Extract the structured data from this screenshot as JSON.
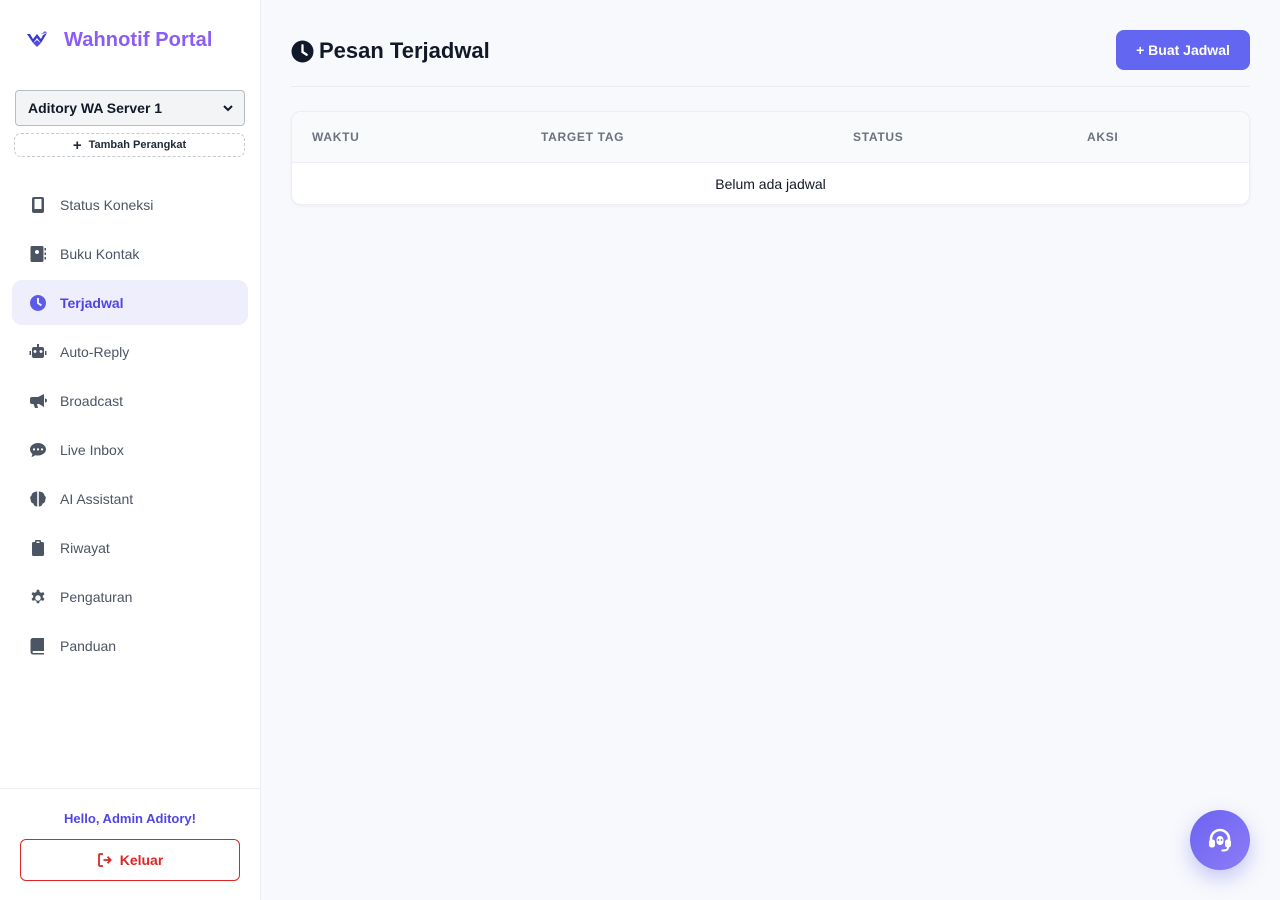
{
  "brand": {
    "title": "Wahnotif Portal",
    "logo_icon": "bird-logo-icon"
  },
  "device": {
    "selected": "Aditory WA Server 1",
    "add_label": "Tambah Perangkat"
  },
  "nav": {
    "items": [
      {
        "label": "Status Koneksi",
        "icon": "phone-icon",
        "active": false
      },
      {
        "label": "Buku Kontak",
        "icon": "address-book-icon",
        "active": false
      },
      {
        "label": "Terjadwal",
        "icon": "clock-icon",
        "active": true
      },
      {
        "label": "Auto-Reply",
        "icon": "robot-icon",
        "active": false
      },
      {
        "label": "Broadcast",
        "icon": "megaphone-icon",
        "active": false
      },
      {
        "label": "Live Inbox",
        "icon": "chat-bubble-icon",
        "active": false
      },
      {
        "label": "AI Assistant",
        "icon": "brain-icon",
        "active": false
      },
      {
        "label": "Riwayat",
        "icon": "clipboard-icon",
        "active": false
      },
      {
        "label": "Pengaturan",
        "icon": "gear-icon",
        "active": false
      },
      {
        "label": "Panduan",
        "icon": "book-icon",
        "active": false
      }
    ]
  },
  "footer": {
    "greeting": "Hello, Admin Aditory!",
    "logout_label": "Keluar"
  },
  "page": {
    "title": "Pesan Terjadwal",
    "create_label": "+ Buat Jadwal"
  },
  "table": {
    "columns": [
      "WAKTU",
      "TARGET TAG",
      "STATUS",
      "AKSI"
    ],
    "empty_message": "Belum ada jadwal"
  },
  "colors": {
    "accent": "#6366f1",
    "brand": "#8b5cf6",
    "danger": "#dc2626",
    "active_bg": "#eeeefd"
  }
}
